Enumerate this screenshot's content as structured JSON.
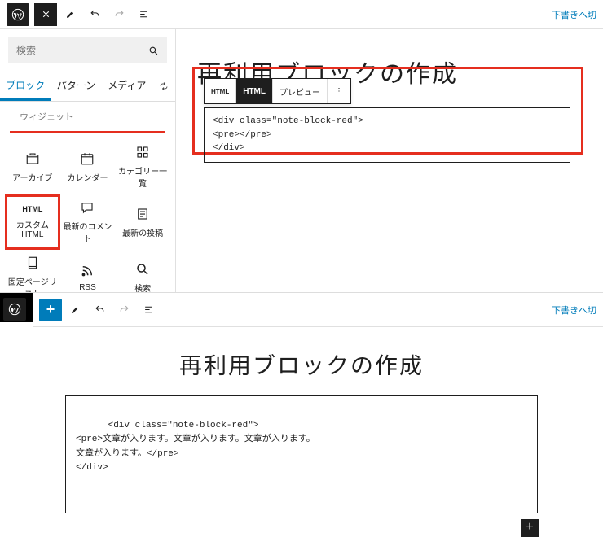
{
  "panel1": {
    "topbar": {
      "draft_link": "下書きへ切"
    },
    "sidebar": {
      "search_placeholder": "検索",
      "tabs": {
        "blocks": "ブロック",
        "patterns": "パターン",
        "media": "メディア"
      },
      "category": "ウィジェット",
      "items": [
        {
          "icon": "📁",
          "label": "アーカイブ"
        },
        {
          "icon": "📅",
          "label": "カレンダー"
        },
        {
          "icon": "▦",
          "label": "カテゴリー一覧"
        },
        {
          "icon": "HTML",
          "label": "カスタム HTML"
        },
        {
          "icon": "💬",
          "label": "最新のコメント"
        },
        {
          "icon": "📄",
          "label": "最新の投稿"
        },
        {
          "icon": "📋",
          "label": "固定ページリスト"
        },
        {
          "icon": "≋",
          "label": "RSS"
        },
        {
          "icon": "🔍",
          "label": "検索"
        },
        {
          "icon": "[/]",
          "label": ""
        },
        {
          "icon": "✎",
          "label": ""
        },
        {
          "icon": "⊕",
          "label": ""
        }
      ]
    },
    "editor": {
      "title": "再利用ブロックの作成",
      "toolbar": {
        "html_tag": "HTML",
        "html_btn": "HTML",
        "preview": "プレビュー"
      },
      "code": "<div class=\"note-block-red\">\n<pre></pre>\n</div>"
    }
  },
  "panel2": {
    "topbar": {
      "draft_link": "下書きへ切"
    },
    "editor": {
      "title": "再利用ブロックの作成",
      "code": "<div class=\"note-block-red\">\n<pre>文章が入ります。文章が入ります。文章が入ります。\n文章が入ります。</pre>\n</div>"
    }
  }
}
